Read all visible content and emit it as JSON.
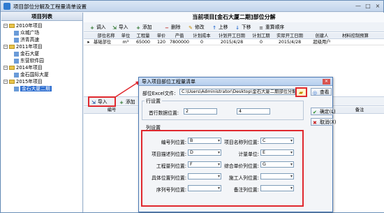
{
  "window": {
    "title": "项目部位分解及工程量清单设置",
    "controls": [
      "—",
      "□",
      "×"
    ]
  },
  "sidebar": {
    "title": "项目列表",
    "items": [
      {
        "label": "2010年项目",
        "type": "group"
      },
      {
        "label": "众城广场",
        "type": "leaf"
      },
      {
        "label": "济青高速",
        "type": "leaf"
      },
      {
        "label": "2011年项目",
        "type": "group"
      },
      {
        "label": "金石大厦",
        "type": "leaf"
      },
      {
        "label": "东营软件园",
        "type": "leaf"
      },
      {
        "label": "2014年项目",
        "type": "group"
      },
      {
        "label": "金石国际大厦",
        "type": "leaf"
      },
      {
        "label": "2015年项目",
        "type": "group"
      },
      {
        "label": "金石大厦二期",
        "type": "leaf",
        "selected": true
      }
    ]
  },
  "main": {
    "title": "当前项目[金石大厦二期]部位分解",
    "toolbar": [
      "调入",
      "导入",
      "添加",
      "删除",
      "修改",
      "上移",
      "下移",
      "重算顺序"
    ],
    "table": {
      "headers": [
        "部位名称",
        "单位",
        "工程量",
        "单价",
        "产值",
        "计划成本",
        "计划开工日期",
        "计划工期",
        "实际开工日期",
        "创建人",
        "材料控制预算"
      ],
      "rows": [
        [
          "基础部位",
          "m³",
          "65000",
          "120",
          "7800000",
          "0",
          "2015/4/28",
          "0",
          "2015/4/28",
          "超级用户",
          ""
        ]
      ]
    },
    "lower_toolbar": [
      "导入",
      "添加"
    ],
    "lower_headers": [
      "编号",
      "备注"
    ]
  },
  "dialog": {
    "title": "导入项目部位工程量清单",
    "file_label": "部位Excel文件:",
    "file_path": "C:\\Users\\Administrator\\Desktop\\金石大厦二期部位分解",
    "view_button": "查看",
    "row_group": "行设置",
    "first_row_label": "首行数据位置:",
    "first_row_value": "2",
    "last_row_value": "4",
    "confirm_button": "确定(L)",
    "cancel_button": "取消(X)",
    "col_group": "列设置",
    "columns": [
      {
        "label": "编号列位置:",
        "value": "B"
      },
      {
        "label": "项目名称列位置:",
        "value": "C"
      },
      {
        "label": "项目描述列位置:",
        "value": "D"
      },
      {
        "label": "计量单位:",
        "value": "E"
      },
      {
        "label": "工程量列位置:",
        "value": "F"
      },
      {
        "label": "综合单价列位置:",
        "value": "G"
      },
      {
        "label": "具体位置列位置:",
        "value": ""
      },
      {
        "label": "施工人列位置:",
        "value": ""
      },
      {
        "label": "序列号列位置:",
        "value": ""
      },
      {
        "label": "备注列位置:",
        "value": ""
      }
    ]
  },
  "colors": {
    "accent": "#2f6fd0",
    "highlight_red": "#e0282e",
    "title_bg": "#c3d5ec"
  }
}
